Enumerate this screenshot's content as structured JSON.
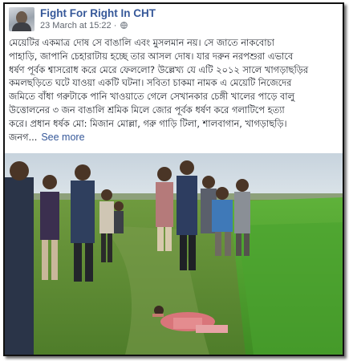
{
  "post": {
    "page_name": "Fight For Right In CHT",
    "timestamp": "23 March at 15:22",
    "separator": " · ",
    "body_lines": [
      "মেয়েটির একমাত্র দোষ সে বাঙালি এবং মুসলমান নয়। সে জাতে নাকবোচা",
      "পাহাড়ি, জাপানি চেহারাটায় হচ্ছে তার আসল দোষ। যার দরুন নরপশুরা এভাবে",
      "ধর্ষণ পূর্বক শ্বাসরোধ করে মেরে ফেললো? উল্লেখ্য যে এটি ২০১২ সালে খাগড়াছড়ির",
      "কমলছড়িতে ঘটে যাওয়া একটি ঘটনা। সবিতা চাকমা নামক এ মেয়েটি নিজেদের",
      "জমিতে বাঁধা গরুটাকে পানি খাওয়াতে গেলে সেখানকার চেঙ্গী খালের পাড়ে বালু",
      "উত্তোলনের ৩ জন বাঙালি শ্রমিক মিলে জোর পূর্বক ধর্ষণ করে গলাটিপে হত্যা",
      "করে। প্রধান ধর্ষক মো: মিজান মোল্লা, গরু গাড়ি টিলা, শালবাগান, খাগড়াছড়ি।"
    ],
    "truncated_line": "জনগ...",
    "see_more_label": "See more"
  },
  "icons": {
    "avatar": "profile-photo",
    "privacy": "globe-icon"
  },
  "colors": {
    "page_name": "#365899",
    "meta": "#616770",
    "text": "#1d2129",
    "link": "#365899"
  }
}
